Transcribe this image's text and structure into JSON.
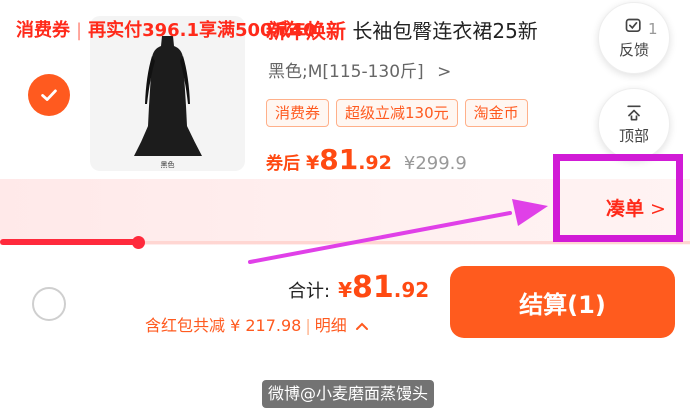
{
  "item": {
    "selected": true,
    "image_caption": "黑色",
    "title_tag": "新年焕新",
    "title": "长袖包臀连衣裙25新",
    "sku": "黑色;M[115-130斤]",
    "sku_chevron": ">",
    "coupon_tags": [
      "消费券",
      "超级立减130元",
      "淘金币"
    ],
    "price_label": "券后",
    "price_currency": "¥",
    "price_int": "81",
    "price_dec": ".92",
    "original_price": "¥299.9"
  },
  "float_buttons": {
    "feedback_label": "反馈",
    "feedback_badge": "1",
    "top_label": "顶部"
  },
  "promo": {
    "label": "消费券",
    "separator": "|",
    "message": "再实付396.1享满500减40",
    "action_label": "凑单",
    "action_chevron": ">",
    "progress": 0.2
  },
  "footer": {
    "total_label": "合计:",
    "total_currency": "¥",
    "total_int": "81",
    "total_dec": ".92",
    "discount_text": "含红包共减 ¥ 217.98",
    "discount_separator": "|",
    "detail_label": "明细",
    "detail_chevron": "^",
    "checkout_label": "结算(1)"
  },
  "watermark": "微博@小麦磨面蒸馒头",
  "colors": {
    "accent": "#ff5b1e",
    "promo_red": "#ff2a1a",
    "highlight": "#d11bd6",
    "arrow": "#e040e8"
  },
  "icons": [
    "check-icon",
    "dress-image",
    "feedback-icon",
    "arrow-up-top-icon",
    "chevron-right-icon",
    "chevron-up-icon"
  ]
}
